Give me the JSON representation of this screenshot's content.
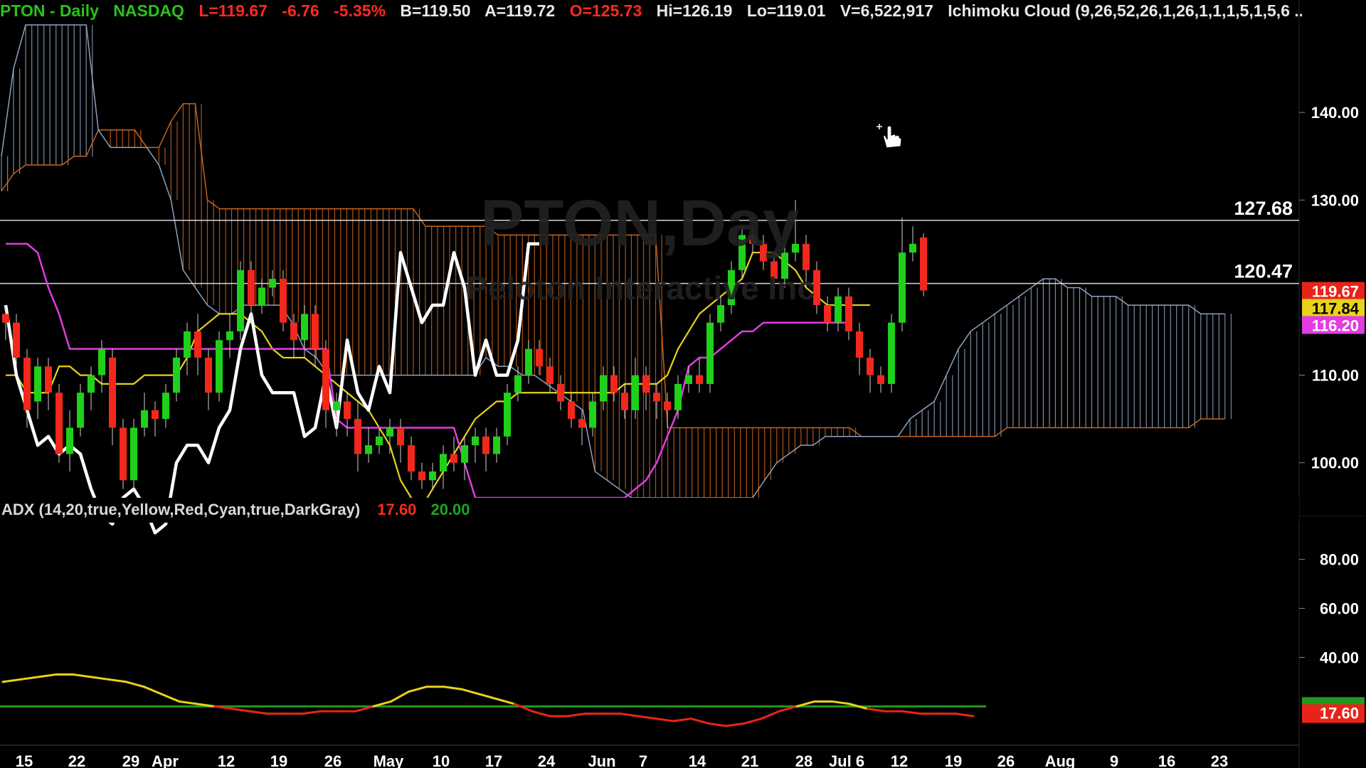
{
  "header": {
    "symbol": "PTON - Daily",
    "exchange": "NASDAQ",
    "last": "L=119.67",
    "change": "-6.76",
    "change_pct": "-5.35%",
    "bid": "B=119.50",
    "ask": "A=119.72",
    "open": "O=125.73",
    "high": "Hi=126.19",
    "low": "Lo=119.01",
    "volume": "V=6,522,917",
    "indicator": "Ichimoku Cloud (9,26,52,26,1,26,1,1,1,5,1,5,6 ..."
  },
  "watermark": {
    "line1": "PTON,Day",
    "line2": "Peloton Interactive Inc"
  },
  "adx_header": {
    "title": "ADX (14,20,true,Yellow,Red,Cyan,true,DarkGray)",
    "value": "17.60",
    "threshold": "20.00"
  },
  "colors": {
    "up": "#1fd11a",
    "down": "#f2281c",
    "conversion": "#e8d21a",
    "base": "#e23ce2",
    "lagging": "#ffffff",
    "cloud_a": "#c8641e",
    "cloud_b": "#8fa2bf",
    "adx_above": "#e8d21a",
    "adx_below": "#e8241a",
    "adx_threshold": "#1f9a1f"
  },
  "chart_data": [
    {
      "type": "candlestick",
      "title": "PTON - Daily",
      "x_tick_labels": [
        "15",
        "22",
        "29",
        "Apr",
        "12",
        "19",
        "26",
        "May",
        "10",
        "17",
        "24",
        "Jun",
        "7",
        "14",
        "21",
        "28",
        "Jul 6",
        "12",
        "19",
        "26",
        "Aug",
        "9",
        "16",
        "23"
      ],
      "y_tick_labels": [
        "140.00",
        "130.00",
        "110.00",
        "100.00"
      ],
      "ylim": [
        96,
        150
      ],
      "horizontal_lines": [
        {
          "value": 127.68,
          "label": "127.68"
        },
        {
          "value": 120.47,
          "label": "120.47"
        }
      ],
      "price_badges": [
        {
          "value": 119.67,
          "label": "119.67",
          "color": "#e8241a"
        },
        {
          "value": 117.84,
          "label": "117.84",
          "color": "#e8d21a"
        },
        {
          "value": 116.2,
          "label": "116.20",
          "color": "#e23ce2"
        }
      ],
      "candles": [
        [
          117,
          116,
          118,
          114
        ],
        [
          116,
          112,
          117,
          111
        ],
        [
          112,
          106,
          113,
          104
        ],
        [
          107,
          111,
          112,
          105
        ],
        [
          111,
          108,
          112,
          106
        ],
        [
          108,
          101,
          109,
          100
        ],
        [
          101,
          104,
          106,
          99
        ],
        [
          104,
          108,
          109,
          103
        ],
        [
          108,
          110,
          111,
          106
        ],
        [
          110,
          113,
          114,
          108
        ],
        [
          112,
          104,
          113,
          102
        ],
        [
          104,
          98,
          105,
          97
        ],
        [
          98,
          104,
          105,
          97
        ],
        [
          104,
          106,
          108,
          103
        ],
        [
          106,
          105,
          107,
          103
        ],
        [
          105,
          108,
          109,
          104
        ],
        [
          108,
          112,
          113,
          107
        ],
        [
          112,
          115,
          116,
          110
        ],
        [
          115,
          112,
          117,
          110
        ],
        [
          112,
          108,
          113,
          106
        ],
        [
          108,
          114,
          115,
          107
        ],
        [
          114,
          115,
          117,
          112
        ],
        [
          115,
          122,
          123,
          114
        ],
        [
          122,
          118,
          123,
          116
        ],
        [
          118,
          120,
          121,
          117
        ],
        [
          120,
          121,
          122,
          119
        ],
        [
          121,
          116,
          122,
          115
        ],
        [
          116,
          114,
          117,
          112
        ],
        [
          114,
          117,
          118,
          112
        ],
        [
          117,
          113,
          118,
          111
        ],
        [
          113,
          106,
          114,
          104
        ],
        [
          106,
          107,
          108,
          103
        ],
        [
          107,
          105,
          108,
          103
        ],
        [
          105,
          101,
          107,
          99
        ],
        [
          101,
          102,
          104,
          100
        ],
        [
          102,
          103,
          104,
          101
        ],
        [
          103,
          104,
          105,
          101
        ],
        [
          104,
          102,
          105,
          100
        ],
        [
          102,
          99,
          103,
          98
        ],
        [
          99,
          98,
          100,
          97
        ],
        [
          98,
          99,
          100,
          97
        ],
        [
          99,
          101,
          102,
          97
        ],
        [
          101,
          100,
          103,
          99
        ],
        [
          100,
          102,
          103,
          98
        ],
        [
          102,
          103,
          104,
          100
        ],
        [
          103,
          101,
          104,
          99
        ],
        [
          101,
          103,
          104,
          100
        ],
        [
          103,
          108,
          109,
          102
        ],
        [
          108,
          110,
          111,
          107
        ],
        [
          110,
          113,
          114,
          109
        ],
        [
          113,
          111,
          114,
          110
        ],
        [
          111,
          109,
          112,
          108
        ],
        [
          109,
          107,
          110,
          106
        ],
        [
          107,
          105,
          108,
          104
        ],
        [
          105,
          104,
          106,
          102
        ],
        [
          104,
          107,
          108,
          103
        ],
        [
          107,
          110,
          111,
          106
        ],
        [
          110,
          108,
          111,
          107
        ],
        [
          108,
          106,
          109,
          105
        ],
        [
          106,
          110,
          112,
          105
        ],
        [
          110,
          108,
          111,
          106
        ],
        [
          108,
          107,
          109,
          105
        ],
        [
          107,
          106,
          108,
          104
        ],
        [
          106,
          109,
          110,
          105
        ],
        [
          109,
          110,
          111,
          108
        ],
        [
          110,
          109,
          112,
          108
        ],
        [
          109,
          116,
          117,
          108
        ],
        [
          116,
          118,
          119,
          115
        ],
        [
          118,
          122,
          123,
          117
        ],
        [
          122,
          126,
          127,
          121
        ],
        [
          126,
          125,
          127,
          124
        ],
        [
          125,
          123,
          126,
          122
        ],
        [
          123,
          121,
          124,
          120
        ],
        [
          121,
          124,
          125,
          120
        ],
        [
          124,
          125,
          130,
          123
        ],
        [
          125,
          122,
          126,
          120
        ],
        [
          122,
          118,
          123,
          117
        ],
        [
          118,
          116,
          119,
          115
        ],
        [
          116,
          119,
          120,
          115
        ],
        [
          119,
          115,
          120,
          114
        ],
        [
          115,
          112,
          116,
          110
        ],
        [
          112,
          110,
          113,
          108
        ],
        [
          110,
          109,
          111,
          108
        ],
        [
          109,
          116,
          117,
          108
        ],
        [
          116,
          124,
          128,
          115
        ],
        [
          124,
          125,
          127,
          123
        ],
        [
          125.73,
          119.67,
          126.19,
          119.01
        ]
      ],
      "series": [
        {
          "name": "conversion",
          "values": [
            110,
            110,
            108,
            108,
            108,
            111,
            111,
            110,
            110,
            109,
            109,
            109,
            109,
            110,
            110,
            110,
            110,
            112,
            115,
            116,
            117,
            117,
            117,
            116,
            115,
            113,
            112,
            112,
            112,
            111,
            110,
            109,
            108,
            107,
            106,
            104,
            102,
            98,
            96,
            95,
            97,
            99,
            101,
            103,
            105,
            106,
            107,
            107,
            108,
            108,
            108,
            108,
            108,
            108,
            108,
            108,
            108,
            108,
            109,
            109,
            109,
            109,
            110,
            113,
            115,
            117,
            118,
            119,
            120,
            121,
            124,
            124,
            124,
            123,
            122,
            120,
            119,
            118,
            118,
            118,
            118,
            118
          ]
        },
        {
          "name": "base",
          "values": [
            125,
            125,
            125,
            124,
            120,
            117,
            113,
            113,
            113,
            113,
            113,
            113,
            113,
            113,
            113,
            113,
            113,
            113,
            113,
            113,
            113,
            113,
            113,
            113,
            113,
            113,
            113,
            113,
            113,
            113,
            113,
            105,
            104,
            104,
            104,
            104,
            104,
            104,
            104,
            104,
            104,
            104,
            104,
            100,
            96,
            96,
            96,
            96,
            96,
            96,
            96,
            96,
            96,
            96,
            96,
            96,
            96,
            96,
            96,
            97,
            98,
            100,
            103,
            106,
            111,
            112,
            112,
            113,
            114,
            115,
            115,
            116,
            116,
            116,
            116,
            116,
            116,
            116,
            116,
            116
          ]
        },
        {
          "name": "lagging",
          "values": [
            118,
            110,
            106,
            102,
            103,
            101,
            102,
            101,
            97,
            94,
            93,
            96,
            97,
            95,
            92,
            93,
            100,
            102,
            102,
            100,
            104,
            106,
            113,
            117,
            110,
            108,
            108,
            108,
            103,
            104,
            110,
            104,
            114,
            108,
            106,
            111,
            108,
            124,
            120,
            116,
            118,
            118,
            124,
            120,
            110,
            114,
            110,
            110,
            114,
            125,
            125
          ]
        }
      ],
      "cloud": {
        "span_a": [
          131,
          133,
          134,
          134,
          134,
          134,
          135,
          135,
          138,
          138,
          138,
          138,
          136,
          136,
          139,
          141,
          141,
          130,
          129,
          129,
          129,
          129,
          129,
          129,
          129,
          129,
          129,
          129,
          129,
          129,
          129,
          129,
          129,
          129,
          129,
          127,
          127,
          127,
          127,
          127,
          127,
          126,
          126,
          126,
          126,
          126,
          126,
          126,
          126,
          126,
          126,
          126,
          126,
          126,
          126,
          104,
          104,
          104,
          104,
          104,
          104,
          104,
          104,
          104,
          104,
          104,
          104,
          104,
          104,
          104,
          104,
          103,
          103,
          103,
          103,
          103,
          103,
          103,
          103,
          103,
          103,
          103,
          103,
          104,
          104,
          104,
          104,
          104,
          104,
          104,
          104,
          104,
          104,
          104,
          104,
          104,
          104,
          104,
          104,
          105,
          105,
          105
        ],
        "span_b": [
          135,
          145,
          150,
          150,
          150,
          150,
          150,
          150,
          138,
          136,
          136,
          136,
          136,
          134,
          130,
          122,
          120,
          118,
          117,
          117,
          118,
          118,
          118,
          118,
          116,
          113,
          112,
          110,
          110,
          110,
          110,
          110,
          110,
          110,
          110,
          110,
          110,
          110,
          110,
          110,
          112,
          111,
          111,
          110,
          110,
          109,
          108,
          107,
          106,
          99,
          98,
          97,
          96,
          96,
          96,
          96,
          96,
          96,
          96,
          96,
          96,
          96,
          96,
          98,
          100,
          101,
          102,
          102,
          103,
          103,
          103,
          103,
          103,
          103,
          103,
          105,
          106,
          107,
          110,
          113,
          115,
          116,
          117,
          118,
          119,
          120,
          121,
          121,
          120,
          120,
          119,
          119,
          119,
          118,
          118,
          118,
          118,
          118,
          118,
          117,
          117,
          117
        ]
      }
    },
    {
      "type": "line",
      "title": "ADX (14,20,true,Yellow,Red,Cyan,true,DarkGray)",
      "y_tick_labels": [
        "80.00",
        "60.00",
        "40.00"
      ],
      "ylim": [
        5,
        95
      ],
      "threshold": 20,
      "current_value": 17.6,
      "threshold_label": "20.00",
      "value_badge": "17.60",
      "values": [
        30,
        31,
        32,
        33,
        33,
        32,
        31,
        30,
        28,
        25,
        22,
        21,
        20,
        19,
        18,
        17,
        17,
        17,
        18,
        18,
        18,
        20,
        22,
        26,
        28,
        28,
        27,
        25,
        23,
        21,
        18,
        16,
        16,
        17,
        17,
        17,
        16,
        15,
        14,
        15,
        13,
        12,
        13,
        15,
        18,
        20,
        22,
        22,
        21,
        19,
        18,
        18,
        17,
        17,
        17,
        16
      ]
    }
  ]
}
